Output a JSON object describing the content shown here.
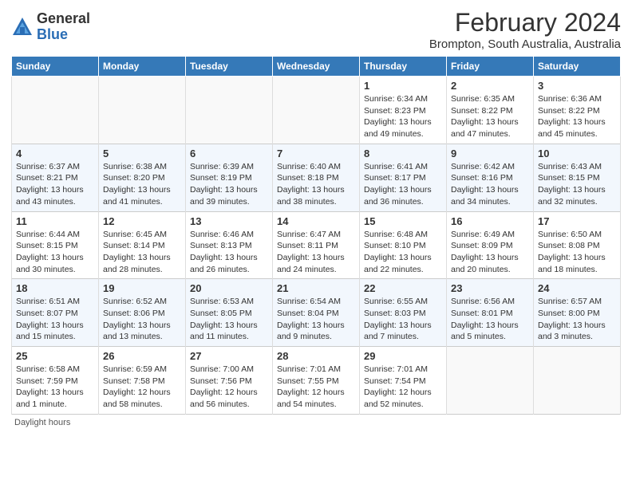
{
  "header": {
    "logo_general": "General",
    "logo_blue": "Blue",
    "title": "February 2024",
    "subtitle": "Brompton, South Australia, Australia"
  },
  "days_of_week": [
    "Sunday",
    "Monday",
    "Tuesday",
    "Wednesday",
    "Thursday",
    "Friday",
    "Saturday"
  ],
  "weeks": [
    [
      {
        "day": "",
        "info": ""
      },
      {
        "day": "",
        "info": ""
      },
      {
        "day": "",
        "info": ""
      },
      {
        "day": "",
        "info": ""
      },
      {
        "day": "1",
        "info": "Sunrise: 6:34 AM\nSunset: 8:23 PM\nDaylight: 13 hours\nand 49 minutes."
      },
      {
        "day": "2",
        "info": "Sunrise: 6:35 AM\nSunset: 8:22 PM\nDaylight: 13 hours\nand 47 minutes."
      },
      {
        "day": "3",
        "info": "Sunrise: 6:36 AM\nSunset: 8:22 PM\nDaylight: 13 hours\nand 45 minutes."
      }
    ],
    [
      {
        "day": "4",
        "info": "Sunrise: 6:37 AM\nSunset: 8:21 PM\nDaylight: 13 hours\nand 43 minutes."
      },
      {
        "day": "5",
        "info": "Sunrise: 6:38 AM\nSunset: 8:20 PM\nDaylight: 13 hours\nand 41 minutes."
      },
      {
        "day": "6",
        "info": "Sunrise: 6:39 AM\nSunset: 8:19 PM\nDaylight: 13 hours\nand 39 minutes."
      },
      {
        "day": "7",
        "info": "Sunrise: 6:40 AM\nSunset: 8:18 PM\nDaylight: 13 hours\nand 38 minutes."
      },
      {
        "day": "8",
        "info": "Sunrise: 6:41 AM\nSunset: 8:17 PM\nDaylight: 13 hours\nand 36 minutes."
      },
      {
        "day": "9",
        "info": "Sunrise: 6:42 AM\nSunset: 8:16 PM\nDaylight: 13 hours\nand 34 minutes."
      },
      {
        "day": "10",
        "info": "Sunrise: 6:43 AM\nSunset: 8:15 PM\nDaylight: 13 hours\nand 32 minutes."
      }
    ],
    [
      {
        "day": "11",
        "info": "Sunrise: 6:44 AM\nSunset: 8:15 PM\nDaylight: 13 hours\nand 30 minutes."
      },
      {
        "day": "12",
        "info": "Sunrise: 6:45 AM\nSunset: 8:14 PM\nDaylight: 13 hours\nand 28 minutes."
      },
      {
        "day": "13",
        "info": "Sunrise: 6:46 AM\nSunset: 8:13 PM\nDaylight: 13 hours\nand 26 minutes."
      },
      {
        "day": "14",
        "info": "Sunrise: 6:47 AM\nSunset: 8:11 PM\nDaylight: 13 hours\nand 24 minutes."
      },
      {
        "day": "15",
        "info": "Sunrise: 6:48 AM\nSunset: 8:10 PM\nDaylight: 13 hours\nand 22 minutes."
      },
      {
        "day": "16",
        "info": "Sunrise: 6:49 AM\nSunset: 8:09 PM\nDaylight: 13 hours\nand 20 minutes."
      },
      {
        "day": "17",
        "info": "Sunrise: 6:50 AM\nSunset: 8:08 PM\nDaylight: 13 hours\nand 18 minutes."
      }
    ],
    [
      {
        "day": "18",
        "info": "Sunrise: 6:51 AM\nSunset: 8:07 PM\nDaylight: 13 hours\nand 15 minutes."
      },
      {
        "day": "19",
        "info": "Sunrise: 6:52 AM\nSunset: 8:06 PM\nDaylight: 13 hours\nand 13 minutes."
      },
      {
        "day": "20",
        "info": "Sunrise: 6:53 AM\nSunset: 8:05 PM\nDaylight: 13 hours\nand 11 minutes."
      },
      {
        "day": "21",
        "info": "Sunrise: 6:54 AM\nSunset: 8:04 PM\nDaylight: 13 hours\nand 9 minutes."
      },
      {
        "day": "22",
        "info": "Sunrise: 6:55 AM\nSunset: 8:03 PM\nDaylight: 13 hours\nand 7 minutes."
      },
      {
        "day": "23",
        "info": "Sunrise: 6:56 AM\nSunset: 8:01 PM\nDaylight: 13 hours\nand 5 minutes."
      },
      {
        "day": "24",
        "info": "Sunrise: 6:57 AM\nSunset: 8:00 PM\nDaylight: 13 hours\nand 3 minutes."
      }
    ],
    [
      {
        "day": "25",
        "info": "Sunrise: 6:58 AM\nSunset: 7:59 PM\nDaylight: 13 hours\nand 1 minute."
      },
      {
        "day": "26",
        "info": "Sunrise: 6:59 AM\nSunset: 7:58 PM\nDaylight: 12 hours\nand 58 minutes."
      },
      {
        "day": "27",
        "info": "Sunrise: 7:00 AM\nSunset: 7:56 PM\nDaylight: 12 hours\nand 56 minutes."
      },
      {
        "day": "28",
        "info": "Sunrise: 7:01 AM\nSunset: 7:55 PM\nDaylight: 12 hours\nand 54 minutes."
      },
      {
        "day": "29",
        "info": "Sunrise: 7:01 AM\nSunset: 7:54 PM\nDaylight: 12 hours\nand 52 minutes."
      },
      {
        "day": "",
        "info": ""
      },
      {
        "day": "",
        "info": ""
      }
    ]
  ],
  "footer": {
    "label": "Daylight hours"
  }
}
